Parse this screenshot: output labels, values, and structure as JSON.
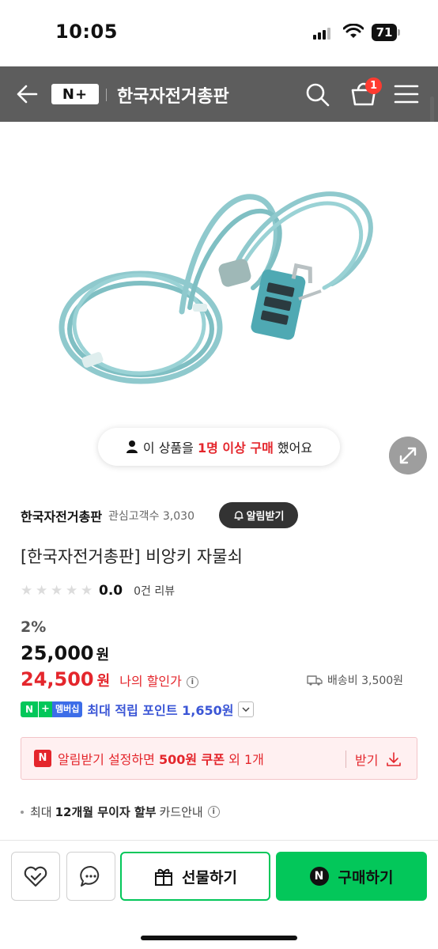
{
  "status_bar": {
    "time": "10:05",
    "battery": "71"
  },
  "header": {
    "title": "한국자전거총판",
    "logo": "N+",
    "cart_count": "1"
  },
  "hero": {
    "buyer_prefix": "이 상품을",
    "buyer_highlight": "1명 이상 구매",
    "buyer_suffix": "했어요"
  },
  "seller": {
    "name": "한국자전거총판",
    "favorites": "관심고객수 3,030",
    "notify_label": "알림받기"
  },
  "product": {
    "title": "[한국자전거총판] 비앙키 자물쇠",
    "rating": "0.0",
    "reviews": "0건 리뷰",
    "discount": "2%",
    "original_price": "25,000",
    "my_price": "24,500",
    "won": "원",
    "my_price_label": "나의 할인가",
    "shipping": "배송비 3,500원"
  },
  "membership": {
    "badge_n": "N",
    "badge_plus": "+",
    "badge_label": "멤버십",
    "points_text": "최대 적립 포인트 1,650원"
  },
  "coupon": {
    "icon": "N",
    "text_prefix": "알림받기 설정하면 ",
    "text_bold": "500원 쿠폰",
    "text_suffix": " 외 1개",
    "get_label": "받기"
  },
  "card": {
    "prefix": "최대",
    "bold": "12개월 무이자 할부",
    "suffix": "카드안내"
  },
  "bottom": {
    "gift_label": "선물하기",
    "buy_label": "구매하기",
    "buy_icon": "N"
  },
  "icons": [
    "back-arrow-icon",
    "search-icon",
    "cart-icon",
    "menu-icon",
    "expand-icon",
    "person-icon",
    "bell-icon",
    "truck-icon",
    "info-icon",
    "download-icon",
    "heart-check-icon",
    "chat-icon",
    "gift-icon"
  ]
}
